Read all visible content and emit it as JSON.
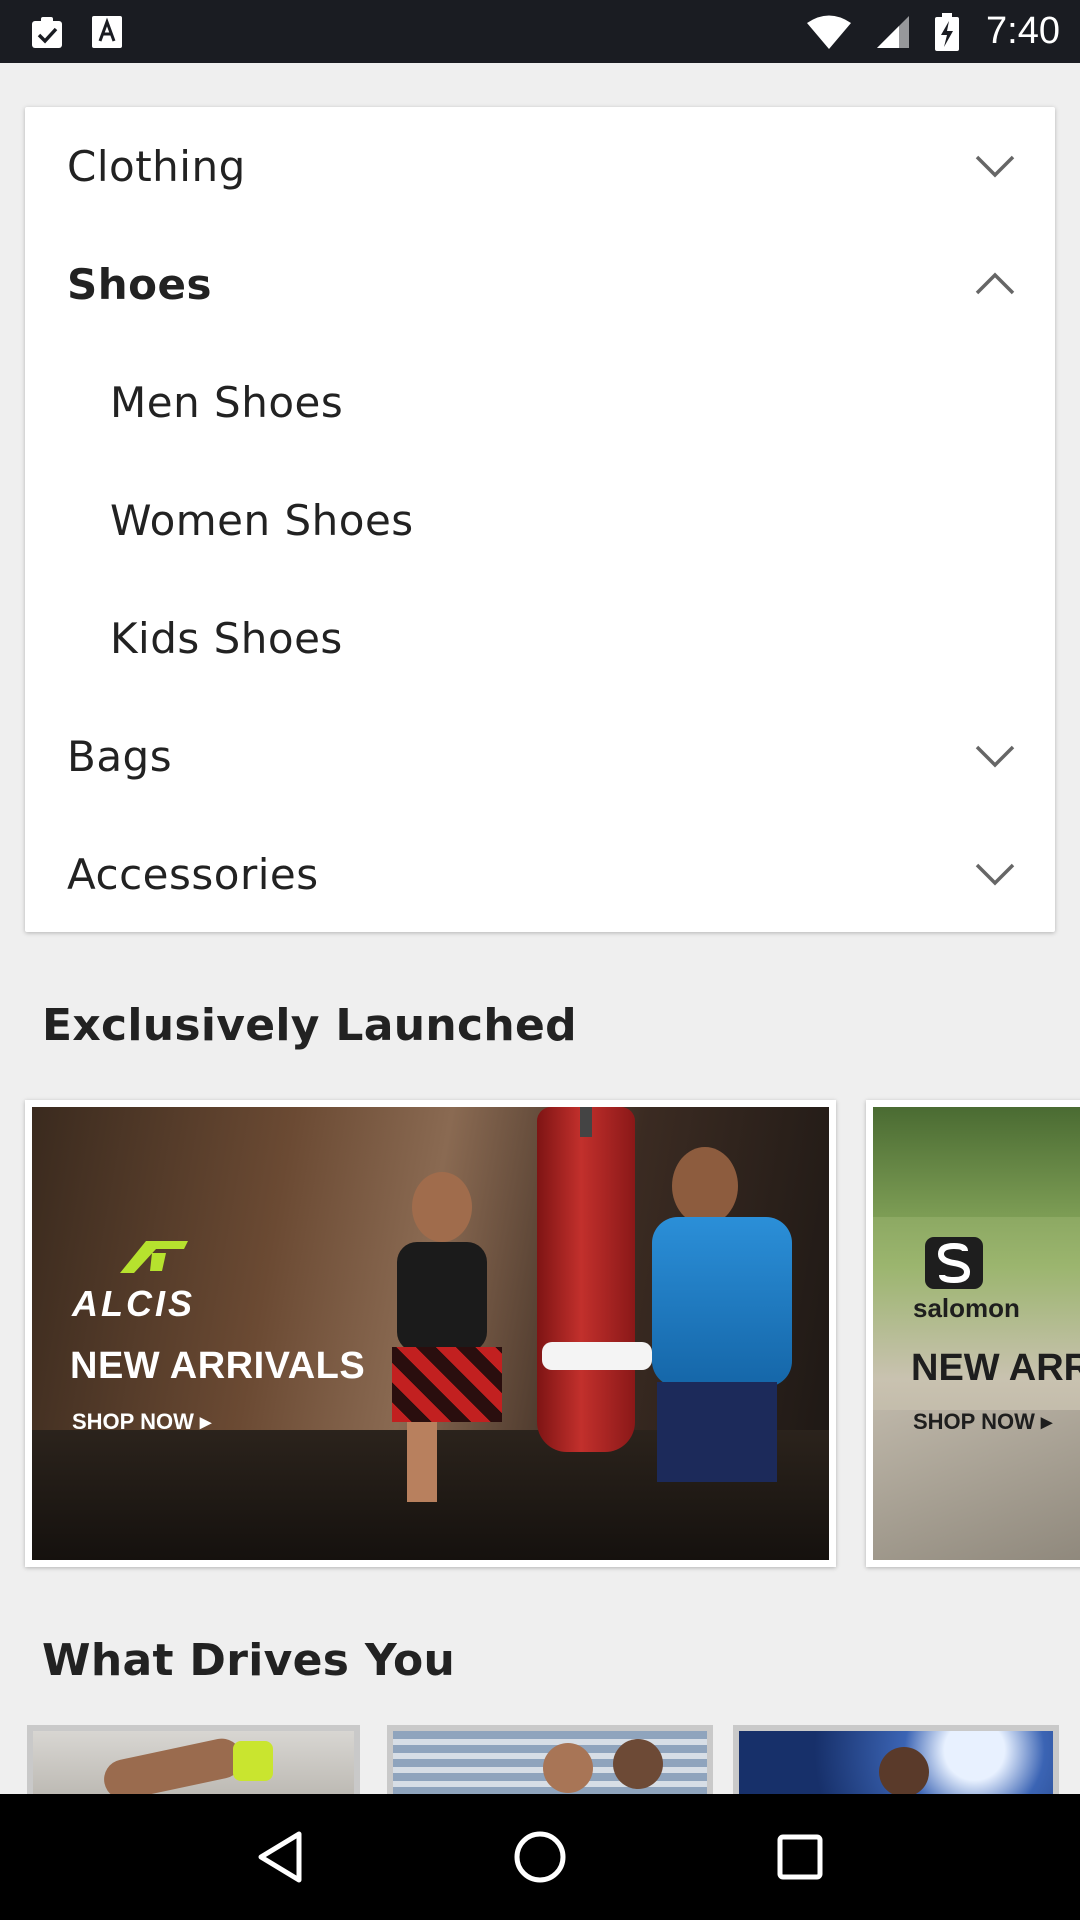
{
  "status_bar": {
    "time": "7:40",
    "icons": [
      "clipboard-check-icon",
      "font-a-icon",
      "wifi-icon",
      "signal-icon",
      "battery-charging-icon"
    ]
  },
  "categories": [
    {
      "label": "Clothing",
      "state": "collapsed"
    },
    {
      "label": "Shoes",
      "state": "expanded",
      "children": [
        "Men Shoes",
        "Women Shoes",
        "Kids Shoes"
      ]
    },
    {
      "label": "Bags",
      "state": "collapsed"
    },
    {
      "label": "Accessories",
      "state": "collapsed"
    }
  ],
  "sections": {
    "exclusive": "Exclusively Launched",
    "drives": "What Drives You"
  },
  "banners": [
    {
      "brand": "ALCIS",
      "headline": "NEW ARRIVALS",
      "cta": "SHOP NOW ▸"
    },
    {
      "brand": "salomon",
      "headline": "NEW ARR",
      "cta": "SHOP NOW ▸"
    }
  ],
  "colors": {
    "accent_green": "#b6e22e",
    "status_bar": "#1a1c22",
    "background": "#efefef"
  }
}
